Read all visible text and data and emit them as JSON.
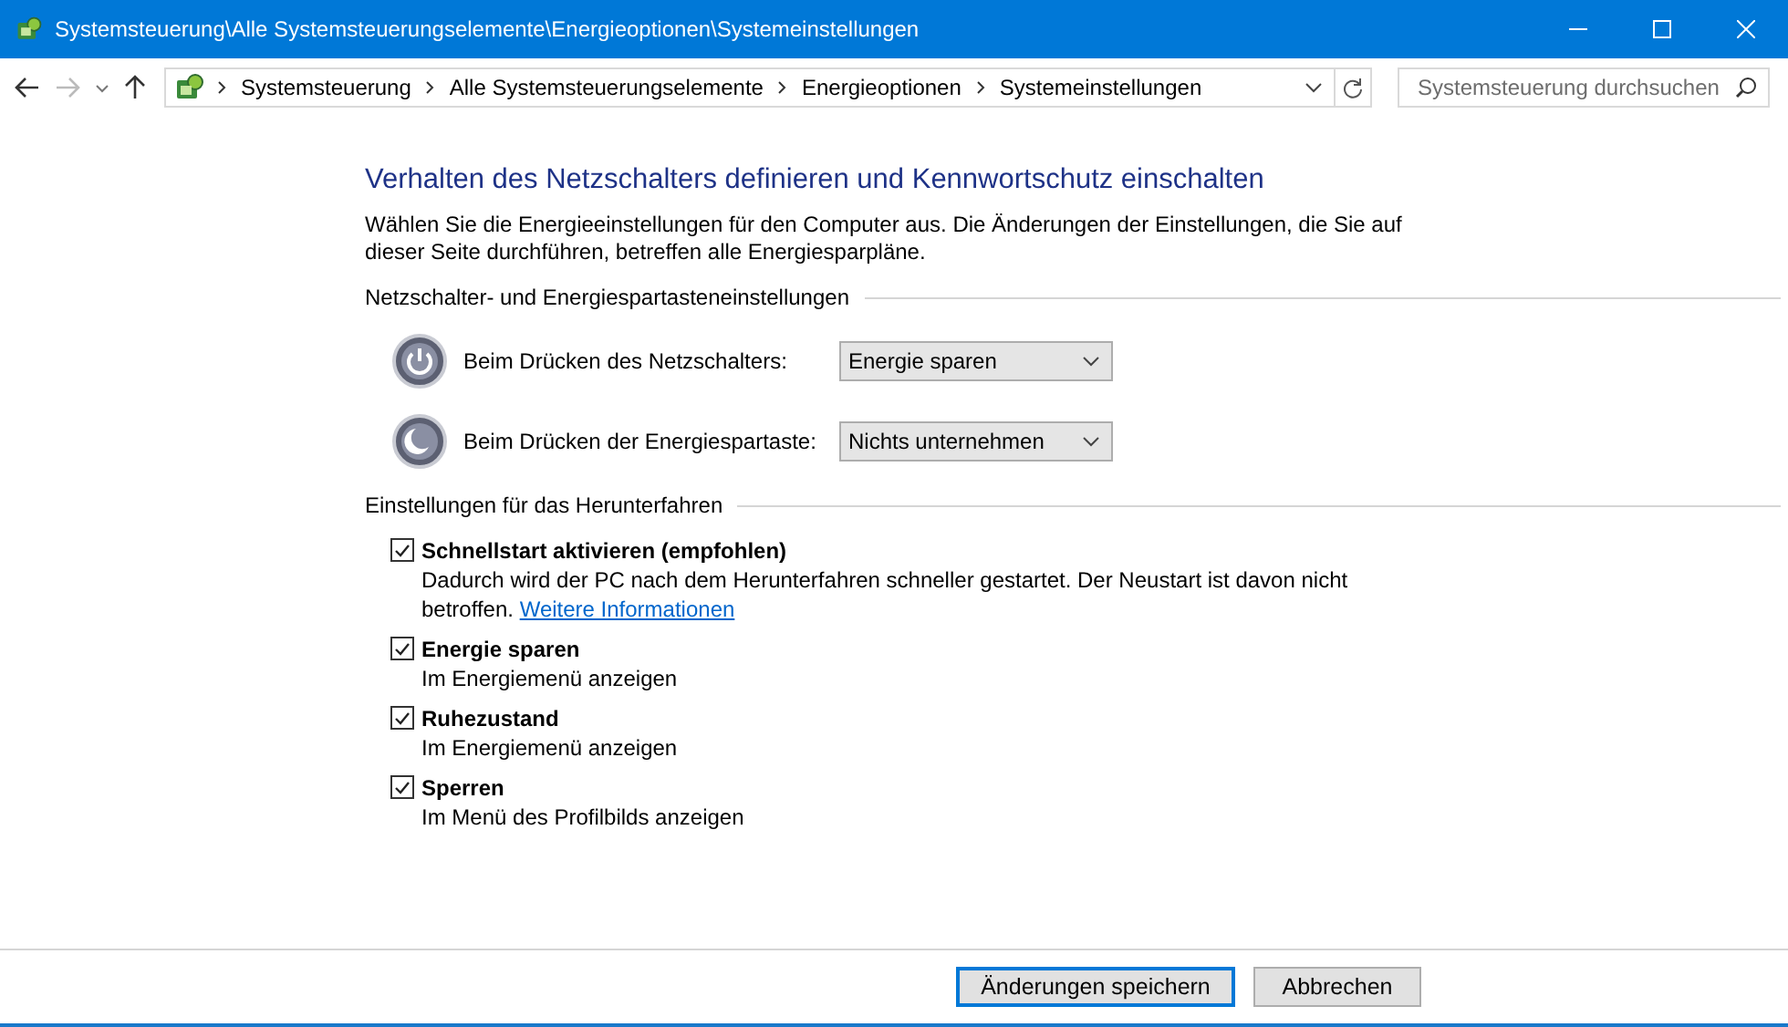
{
  "window": {
    "title": "Systemsteuerung\\Alle Systemsteuerungselemente\\Energieoptionen\\Systemeinstellungen"
  },
  "address_bar": {
    "segments": [
      "Systemsteuerung",
      "Alle Systemsteuerungselemente",
      "Energieoptionen",
      "Systemeinstellungen"
    ],
    "search_placeholder": "Systemsteuerung durchsuchen"
  },
  "heading": "Verhalten des Netzschalters definieren und Kennwortschutz einschalten",
  "intro": "Wählen Sie die Energieeinstellungen für den Computer aus. Die Änderungen der Einstellungen, die Sie auf dieser Seite durchführen, betreffen alle Energiesparpläne.",
  "button_section": {
    "title": "Netzschalter- und Energiespartasteneinstellungen",
    "rows": [
      {
        "kind": "power",
        "label": "Beim Drücken des Netzschalters:",
        "value": "Energie sparen"
      },
      {
        "kind": "sleep",
        "label": "Beim Drücken der Energiespartaste:",
        "value": "Nichts unternehmen"
      }
    ]
  },
  "shutdown_section": {
    "title": "Einstellungen für das Herunterfahren",
    "options": [
      {
        "label": "Schnellstart aktivieren (empfohlen)",
        "checked": true,
        "description": "Dadurch wird der PC nach dem Herunterfahren schneller gestartet. Der Neustart ist davon nicht betroffen.",
        "link": "Weitere Informationen"
      },
      {
        "label": "Energie sparen",
        "checked": true,
        "description": "Im Energiemenü anzeigen"
      },
      {
        "label": "Ruhezustand",
        "checked": true,
        "description": "Im Energiemenü anzeigen"
      },
      {
        "label": "Sperren",
        "checked": true,
        "description": "Im Menü des Profilbilds anzeigen"
      }
    ]
  },
  "buttons": [
    {
      "label": "Änderungen speichern",
      "default": true
    },
    {
      "label": "Abbrechen",
      "default": false
    }
  ]
}
